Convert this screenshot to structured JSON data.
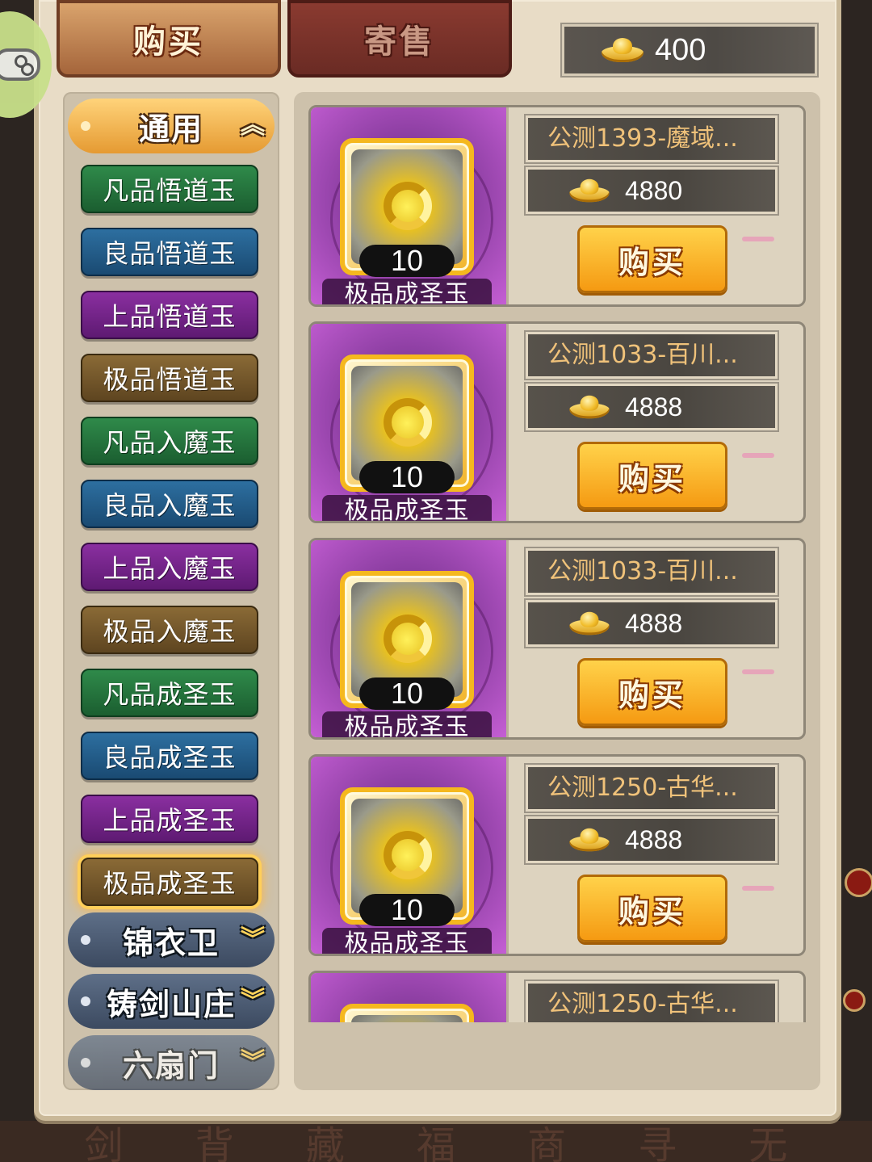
{
  "tabs": {
    "buy_label": "购买",
    "consign_label": "寄售"
  },
  "currency": {
    "icon": "gold-ingot-icon",
    "amount": "400"
  },
  "categories": {
    "general": "通用",
    "items": [
      "凡品悟道玉",
      "良品悟道玉",
      "上品悟道玉",
      "极品悟道玉",
      "凡品入魔玉",
      "良品入魔玉",
      "上品入魔玉",
      "极品入魔玉",
      "凡品成圣玉",
      "良品成圣玉",
      "上品成圣玉",
      "极品成圣玉"
    ],
    "selected_index": 11,
    "groups": [
      "锦衣卫",
      "铸剑山庄",
      "六扇门"
    ]
  },
  "listings": [
    {
      "item_name": "极品成圣玉",
      "quantity": "10",
      "seller": "公测1393-魔域...",
      "price": "4880",
      "buy_label": "购买"
    },
    {
      "item_name": "极品成圣玉",
      "quantity": "10",
      "seller": "公测1033-百川...",
      "price": "4888",
      "buy_label": "购买"
    },
    {
      "item_name": "极品成圣玉",
      "quantity": "10",
      "seller": "公测1033-百川...",
      "price": "4888",
      "buy_label": "购买"
    },
    {
      "item_name": "极品成圣玉",
      "quantity": "10",
      "seller": "公测1250-古华...",
      "price": "4888",
      "buy_label": "购买"
    },
    {
      "seller": "公测1250-古华..."
    }
  ],
  "background": {
    "bottom_glyphs": [
      "剑",
      "背",
      "藏",
      "福",
      "商",
      "寻",
      "无"
    ]
  },
  "colors": {
    "parchment": "#e8dcc6",
    "tab_active": "#c8864e",
    "tab_inactive": "#7a3228",
    "buy_button": "#f8b42a",
    "seller_text": "#f0c27a"
  }
}
